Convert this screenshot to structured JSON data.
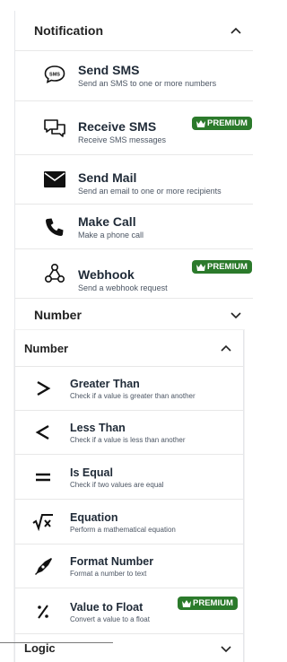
{
  "notification_panel": {
    "header": "Notification",
    "items": [
      {
        "title": "Send SMS",
        "desc": "Send an SMS to one or more numbers",
        "icon": "sms-bubble-icon",
        "premium": false
      },
      {
        "title": "Receive SMS",
        "desc": "Receive SMS messages",
        "icon": "chat-bubbles-icon",
        "premium": true
      },
      {
        "title": "Send Mail",
        "desc": "Send an email to one or more recipients",
        "icon": "envelope-icon",
        "premium": false
      },
      {
        "title": "Make Call",
        "desc": "Make a phone call",
        "icon": "phone-icon",
        "premium": false
      },
      {
        "title": "Webhook",
        "desc": "Send a webhook request",
        "icon": "webhook-icon",
        "premium": true
      }
    ],
    "collapsed_section": "Number"
  },
  "number_panel": {
    "header": "Number",
    "items": [
      {
        "title": "Greater Than",
        "desc": "Check if a value is greater than another",
        "icon": "greater-than-icon",
        "premium": false
      },
      {
        "title": "Less Than",
        "desc": "Check if a value is less than another",
        "icon": "less-than-icon",
        "premium": false
      },
      {
        "title": "Is Equal",
        "desc": "Check if two values are equal",
        "icon": "equals-icon",
        "premium": false
      },
      {
        "title": "Equation",
        "desc": "Perform a mathematical equation",
        "icon": "square-root-icon",
        "premium": false
      },
      {
        "title": "Format Number",
        "desc": "Format a number to text",
        "icon": "pen-icon",
        "premium": false
      },
      {
        "title": "Value to Float",
        "desc": "Convert a value to a float",
        "icon": "percent-icon",
        "premium": true
      }
    ],
    "collapsed_section": "Logic"
  },
  "premium_label": "PREMIUM",
  "colors": {
    "premium_badge": "#2b7a2b",
    "text": "#1f2a37",
    "border": "#e8e8e8"
  }
}
